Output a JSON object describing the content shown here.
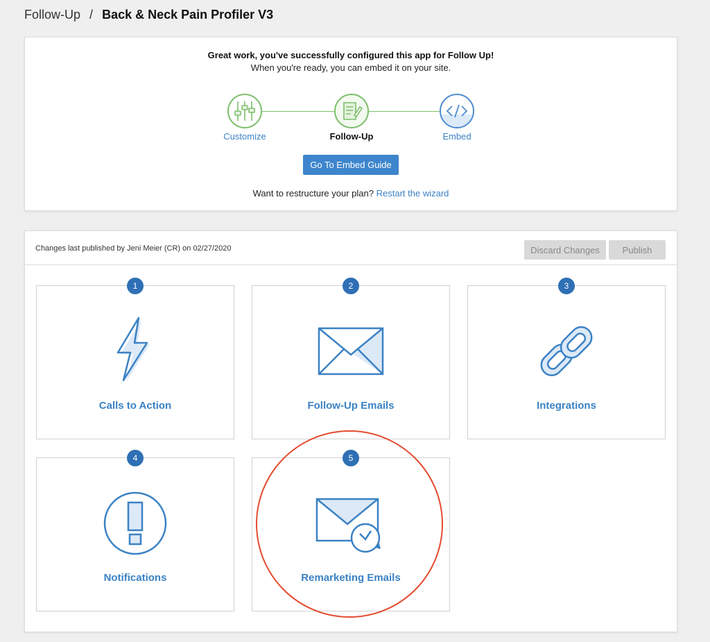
{
  "breadcrumb": {
    "parent": "Follow-Up",
    "separator": "/",
    "current": "Back & Neck Pain Profiler V3"
  },
  "wizard": {
    "title": "Great work, you've successfully configured this app for Follow Up!",
    "subtitle": "When you're ready, you can embed it on your site.",
    "steps": [
      {
        "label": "Customize",
        "status": "done",
        "icon": "sliders-icon"
      },
      {
        "label": "Follow-Up",
        "status": "current",
        "icon": "document-pen-icon"
      },
      {
        "label": "Embed",
        "status": "todo",
        "icon": "code-icon"
      }
    ],
    "embed_button": "Go To Embed Guide",
    "restructure_prefix": "Want to restructure your plan?",
    "restart_link": "Restart the wizard"
  },
  "publish_bar": {
    "status_text": "Changes last published by Jeni Meier (CR) on 02/27/2020",
    "discard_label": "Discard Changes",
    "publish_label": "Publish"
  },
  "tiles": [
    {
      "number": "1",
      "label": "Calls to Action",
      "icon": "lightning-icon"
    },
    {
      "number": "2",
      "label": "Follow-Up Emails",
      "icon": "envelope-icon"
    },
    {
      "number": "3",
      "label": "Integrations",
      "icon": "link-icon"
    },
    {
      "number": "4",
      "label": "Notifications",
      "icon": "alert-icon"
    },
    {
      "number": "5",
      "label": "Remarketing Emails",
      "icon": "envelope-clock-icon"
    }
  ],
  "colors": {
    "accent": "#3b82c4",
    "badge": "#2f6fb5",
    "success": "#7cbf6a",
    "highlight": "#e34b2f"
  }
}
